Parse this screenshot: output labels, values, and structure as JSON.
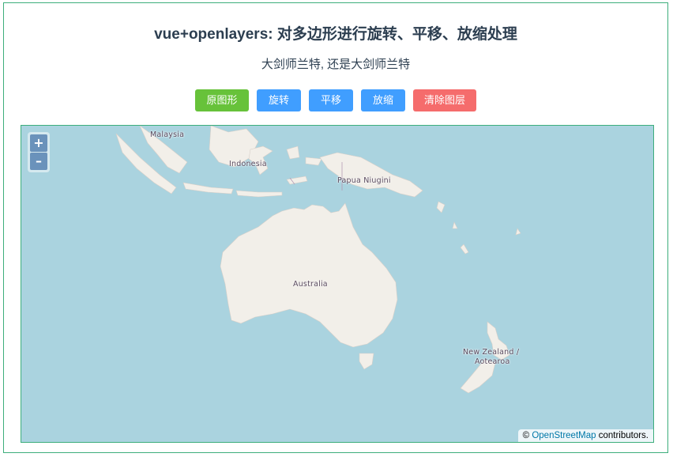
{
  "header": {
    "title": "vue+openlayers: 对多边形进行旋转、平移、放缩处理",
    "subtitle": "大剑师兰特, 还是大剑师兰特"
  },
  "buttons": {
    "original": "原图形",
    "rotate": "旋转",
    "translate": "平移",
    "scale": "放缩",
    "clear": "清除图层"
  },
  "colors": {
    "success": "#67c23a",
    "primary": "#409eff",
    "danger": "#f56c6c",
    "border": "#3dae7c",
    "ocean": "#aad3df",
    "land": "#f2efe9"
  },
  "map": {
    "zoom_in": "+",
    "zoom_out": "–",
    "attribution_prefix": "©",
    "attribution_link": "OpenStreetMap",
    "attribution_suffix": "contributors.",
    "labels": {
      "malaysia": "Malaysia",
      "indonesia": "Indonesia",
      "png": "Papua Niugini",
      "australia": "Australia",
      "nz_line1": "New Zealand /",
      "nz_line2": "Aotearoa"
    }
  }
}
